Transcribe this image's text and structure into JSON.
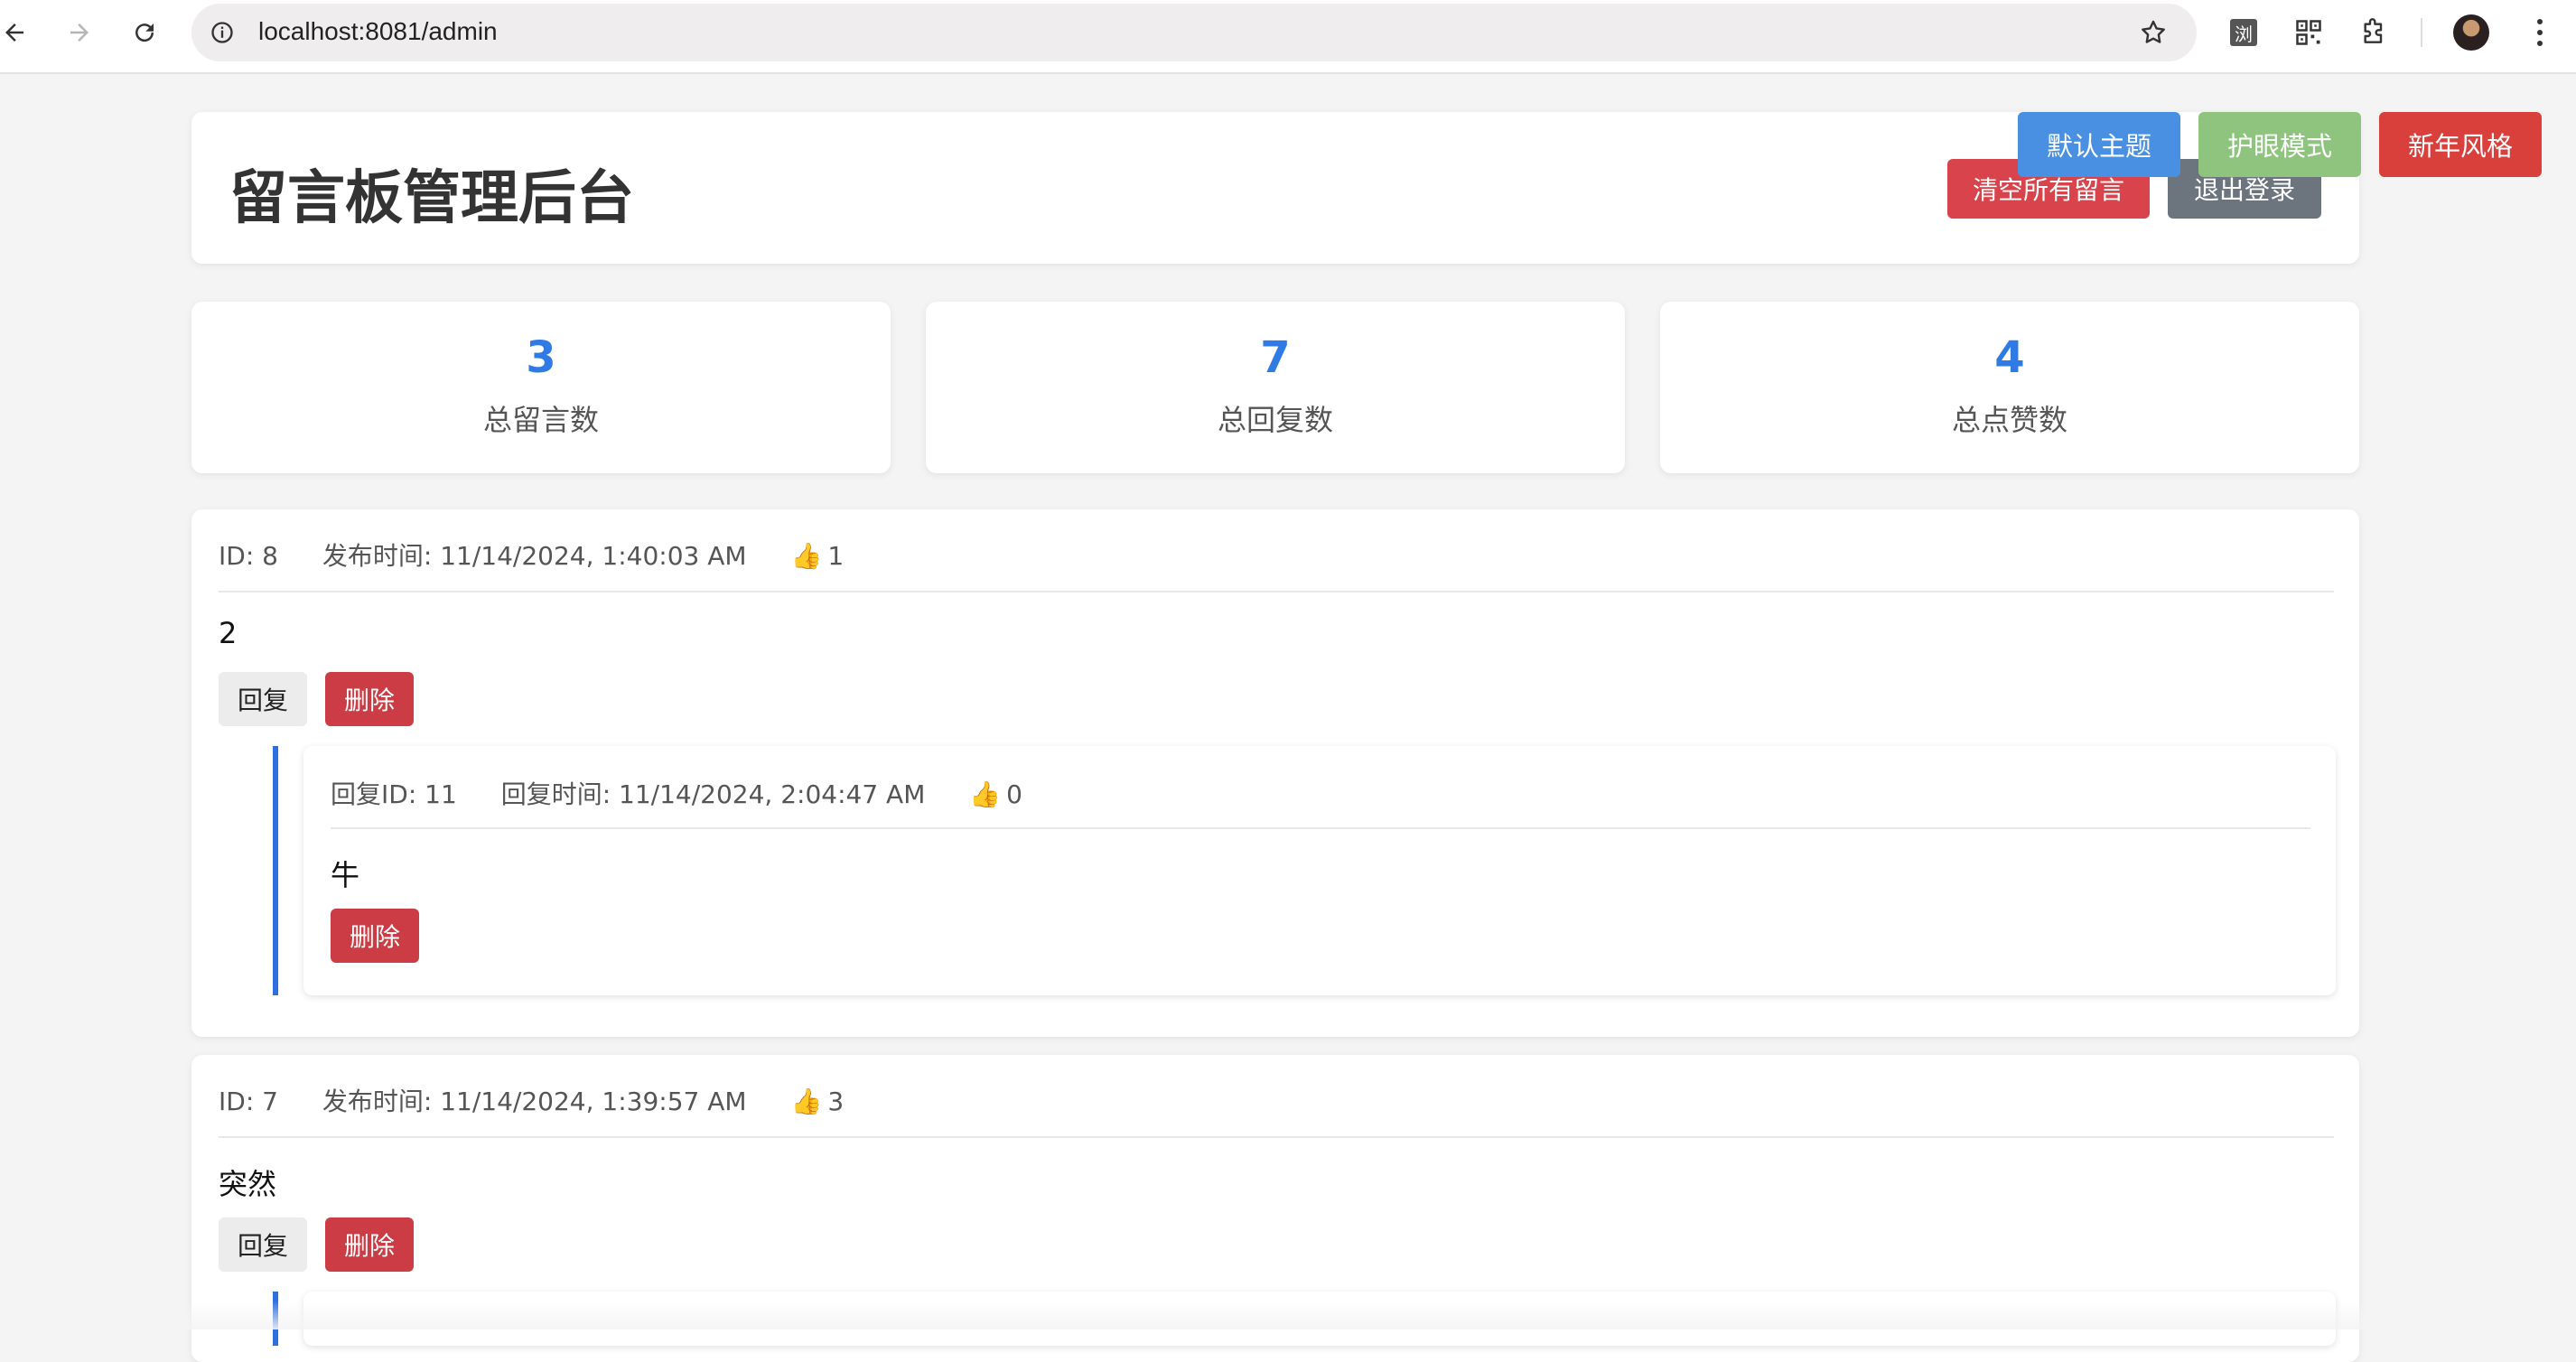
{
  "browser": {
    "url": "localhost:8081/admin",
    "extension_label": "浏"
  },
  "header": {
    "title": "留言板管理后台",
    "clear_all_label": "清空所有留言",
    "logout_label": "退出登录"
  },
  "themes": {
    "default_label": "默认主题",
    "eye_care_label": "护眼模式",
    "new_year_label": "新年风格"
  },
  "stats": [
    {
      "value": "3",
      "label": "总留言数"
    },
    {
      "value": "7",
      "label": "总回复数"
    },
    {
      "value": "4",
      "label": "总点赞数"
    }
  ],
  "messages": [
    {
      "id_text": "ID: 8",
      "time_text": "发布时间: 11/14/2024, 1:40:03 AM",
      "likes": "1",
      "content": "2",
      "reply_label": "回复",
      "delete_label": "删除",
      "replies": [
        {
          "id_text": "回复ID: 11",
          "time_text": "回复时间: 11/14/2024, 2:04:47 AM",
          "likes": "0",
          "content": "牛",
          "delete_label": "删除"
        }
      ]
    },
    {
      "id_text": "ID: 7",
      "time_text": "发布时间: 11/14/2024, 1:39:57 AM",
      "likes": "3",
      "content": "突然",
      "reply_label": "回复",
      "delete_label": "删除"
    }
  ],
  "colors": {
    "accent_blue": "#2f7ae5",
    "danger_red": "#cc3c44",
    "theme_default": "#4a90e2",
    "theme_eye": "#8fc47f",
    "theme_newyear": "#d9403c",
    "logout_gray": "#6c757d"
  }
}
